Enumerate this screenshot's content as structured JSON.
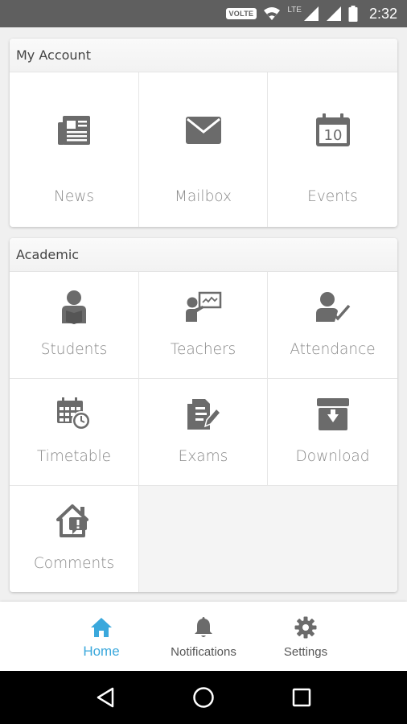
{
  "status_bar": {
    "volte": "VOLTE",
    "network": "LTE",
    "time": "2:32"
  },
  "my_account": {
    "title": "My Account",
    "items": [
      {
        "label": "News",
        "icon": "newspaper-icon"
      },
      {
        "label": "Mailbox",
        "icon": "envelope-icon"
      },
      {
        "label": "Events",
        "icon": "calendar-icon",
        "icon_text": "10"
      }
    ]
  },
  "academic": {
    "title": "Academic",
    "items": [
      {
        "label": "Students",
        "icon": "student-icon"
      },
      {
        "label": "Teachers",
        "icon": "teacher-board-icon"
      },
      {
        "label": "Attendance",
        "icon": "user-check-icon"
      },
      {
        "label": "Timetable",
        "icon": "calendar-clock-icon"
      },
      {
        "label": "Exams",
        "icon": "exam-pencil-icon"
      },
      {
        "label": "Download",
        "icon": "download-box-icon"
      },
      {
        "label": "Comments",
        "icon": "house-comment-icon"
      }
    ]
  },
  "bottom_nav": {
    "items": [
      {
        "label": "Home",
        "icon": "home-icon",
        "active": true
      },
      {
        "label": "Notifications",
        "icon": "bell-icon",
        "active": false
      },
      {
        "label": "Settings",
        "icon": "gear-icon",
        "active": false
      }
    ]
  },
  "colors": {
    "accent": "#3aa8dc",
    "icon": "#6b6b6b",
    "label": "#8a8a8a",
    "status_bar": "#5f5f5f"
  }
}
